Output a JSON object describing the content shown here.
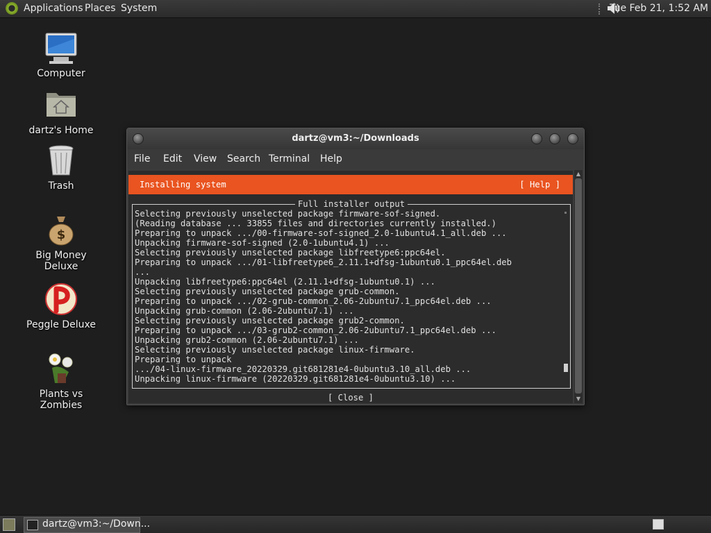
{
  "top_panel": {
    "menus": [
      "Applications",
      "Places",
      "System"
    ],
    "clock": "Tue Feb 21,  1:52 AM"
  },
  "desktop_icons": [
    {
      "label": "Computer",
      "icon": "computer-icon"
    },
    {
      "label": "dartz's Home",
      "icon": "home-folder-icon"
    },
    {
      "label": "Trash",
      "icon": "trash-icon"
    },
    {
      "label": "Big Money Deluxe",
      "icon": "money-bag-icon"
    },
    {
      "label": "Peggle Deluxe",
      "icon": "peggle-icon"
    },
    {
      "label": "Plants vs Zombies",
      "icon": "plants-icon"
    }
  ],
  "terminal": {
    "title": "dartz@vm3:~/Downloads",
    "menu": [
      "File",
      "Edit",
      "View",
      "Search",
      "Terminal",
      "Help"
    ],
    "installer": {
      "header": "Installing system",
      "help_button": "[ Help ]",
      "output_title": "Full installer output",
      "lines": [
        "Selecting previously unselected package firmware-sof-signed.",
        "(Reading database ... 33855 files and directories currently installed.)",
        "Preparing to unpack .../00-firmware-sof-signed_2.0-1ubuntu4.1_all.deb ...",
        "Unpacking firmware-sof-signed (2.0-1ubuntu4.1) ...",
        "Selecting previously unselected package libfreetype6:ppc64el.",
        "Preparing to unpack .../01-libfreetype6_2.11.1+dfsg-1ubuntu0.1_ppc64el.deb",
        "...",
        "Unpacking libfreetype6:ppc64el (2.11.1+dfsg-1ubuntu0.1) ...",
        "Selecting previously unselected package grub-common.",
        "Preparing to unpack .../02-grub-common_2.06-2ubuntu7.1_ppc64el.deb ...",
        "Unpacking grub-common (2.06-2ubuntu7.1) ...",
        "Selecting previously unselected package grub2-common.",
        "Preparing to unpack .../03-grub2-common_2.06-2ubuntu7.1_ppc64el.deb ...",
        "Unpacking grub2-common (2.06-2ubuntu7.1) ...",
        "Selecting previously unselected package linux-firmware.",
        "Preparing to unpack",
        ".../04-linux-firmware_20220329.git681281e4-0ubuntu3.10_all.deb ...",
        "Unpacking linux-firmware (20220329.git681281e4-0ubuntu3.10) ..."
      ],
      "close_button": "[ Close      ]"
    },
    "accent_color": "#e95420"
  },
  "bottom_panel": {
    "task_label": "dartz@vm3:~/Down..."
  }
}
